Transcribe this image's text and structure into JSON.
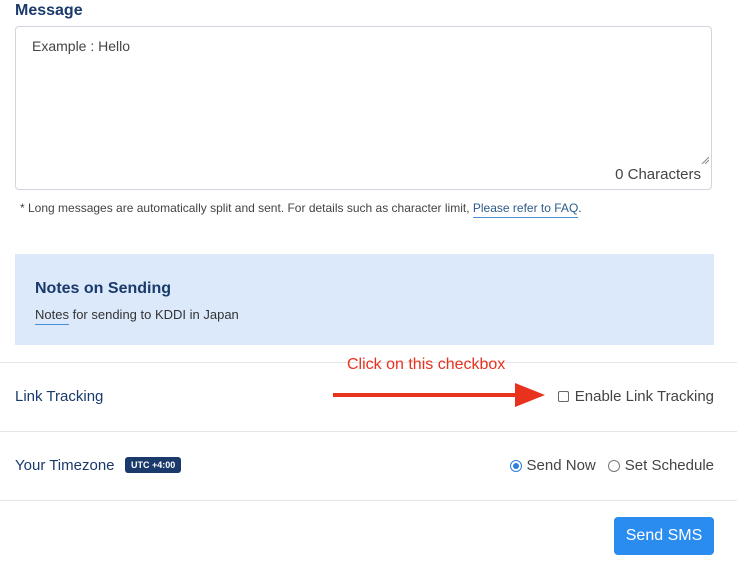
{
  "message": {
    "title": "Message",
    "placeholder": "Example : Hello",
    "char_count": "0 Characters",
    "note_prefix": "* Long messages are automatically split and sent. For details such as character limit,",
    "faq_link": "Please refer to FAQ",
    "note_suffix": "."
  },
  "notes": {
    "title": "Notes on Sending",
    "link": "Notes",
    "text": " for sending to KDDI in Japan"
  },
  "annotation": {
    "hint": "Click on this checkbox",
    "arrow_color": "#e8321e"
  },
  "link_tracking": {
    "label": "Link Tracking",
    "checkbox_label": "Enable Link Tracking",
    "checked": false
  },
  "timezone": {
    "label": "Your Timezone",
    "badge": "UTC +4:00",
    "options": [
      {
        "label": "Send Now",
        "selected": true
      },
      {
        "label": "Set Schedule",
        "selected": false
      }
    ]
  },
  "send_button": {
    "label": "Send SMS",
    "color": "#2b8cf0"
  }
}
